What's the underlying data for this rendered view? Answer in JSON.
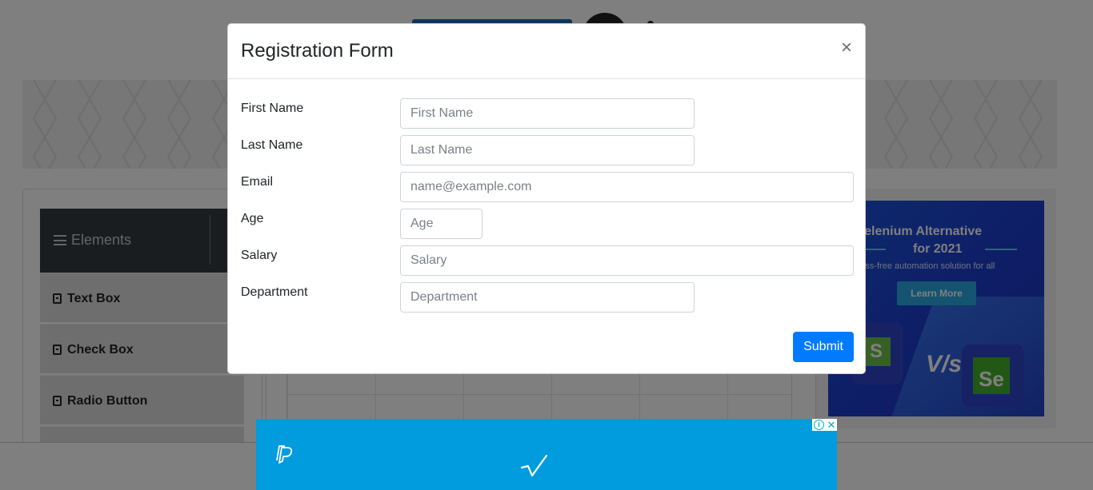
{
  "sidebar": {
    "header_label": "Elements",
    "items": [
      {
        "label": "Text Box"
      },
      {
        "label": "Check Box"
      },
      {
        "label": "Radio Button"
      }
    ]
  },
  "side_ad": {
    "title_line1": "ur Selenium Alternative",
    "title_line2": "for 2021",
    "subtitle": "stress-free automation solution for all",
    "button_label": "Learn More",
    "tile_left_letter": "S",
    "vs_text": "V/s",
    "tile_right_letter": "Se"
  },
  "modal": {
    "title": "Registration Form",
    "close_label": "×",
    "fields": {
      "first_name": {
        "label": "First Name",
        "placeholder": "First Name",
        "value": ""
      },
      "last_name": {
        "label": "Last Name",
        "placeholder": "Last Name",
        "value": ""
      },
      "email": {
        "label": "Email",
        "placeholder": "name@example.com",
        "value": ""
      },
      "age": {
        "label": "Age",
        "placeholder": "Age",
        "value": ""
      },
      "salary": {
        "label": "Salary",
        "placeholder": "Salary",
        "value": ""
      },
      "department": {
        "label": "Department",
        "placeholder": "Department",
        "value": ""
      }
    },
    "submit_label": "Submit"
  },
  "colors": {
    "submit_button": "#007bff",
    "bottom_ad_background": "#009cde",
    "sidebar_header": "#343a40"
  }
}
